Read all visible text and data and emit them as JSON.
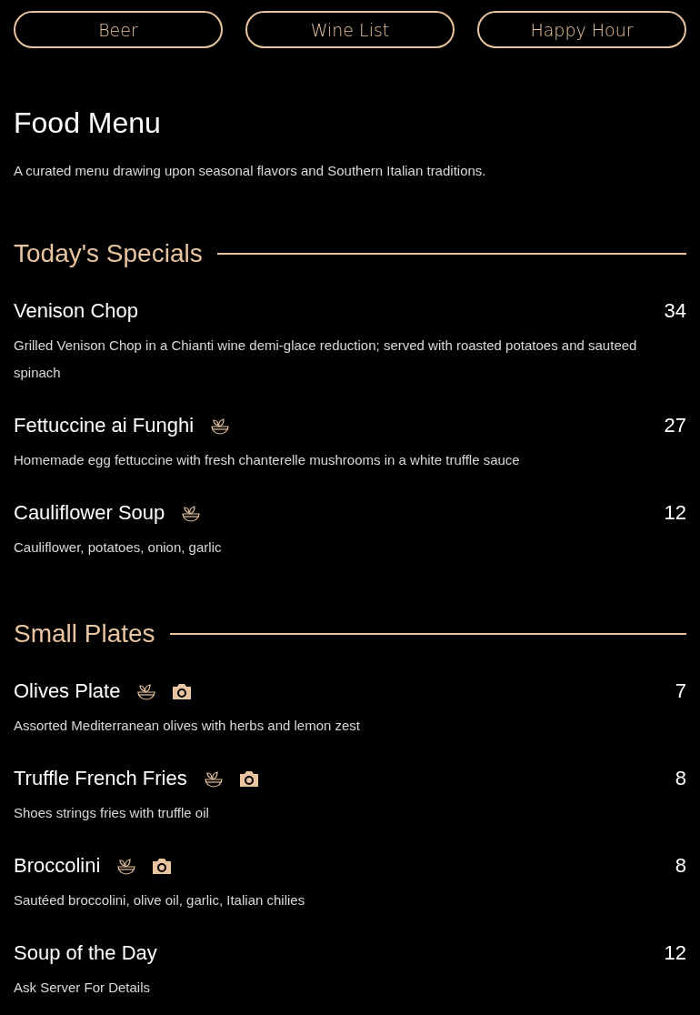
{
  "nav_buttons": [
    "Beer",
    "Wine List",
    "Happy Hour"
  ],
  "title": "Food Menu",
  "description": "A curated menu drawing upon seasonal flavors and Southern Italian traditions.",
  "sections": [
    {
      "heading": "Today's Specials",
      "items": [
        {
          "name": "Venison Chop",
          "price": "34",
          "description": "Grilled Venison Chop in a Chianti wine demi-glace reduction; served with roasted potatoes and sauteed spinach",
          "vegetarian": false,
          "photo": false
        },
        {
          "name": "Fettuccine ai Funghi",
          "price": "27",
          "description": "Homemade egg fettuccine with fresh chanterelle mushrooms in a white truffle sauce",
          "vegetarian": true,
          "photo": false
        },
        {
          "name": "Cauliflower Soup",
          "price": "12",
          "description": "Cauliflower, potatoes, onion, garlic",
          "vegetarian": true,
          "photo": false
        }
      ]
    },
    {
      "heading": "Small Plates",
      "items": [
        {
          "name": "Olives Plate",
          "price": "7",
          "description": "Assorted Mediterranean olives with herbs and lemon zest",
          "vegetarian": true,
          "photo": true
        },
        {
          "name": "Truffle French Fries",
          "price": "8",
          "description": "Shoes strings fries with truffle oil",
          "vegetarian": true,
          "photo": true
        },
        {
          "name": "Broccolini",
          "price": "8",
          "description": "Sautéed broccolini, olive oil, garlic, Italian chilies",
          "vegetarian": true,
          "photo": true
        },
        {
          "name": "Soup of the Day",
          "price": "12",
          "description": "Ask Server For Details",
          "vegetarian": false,
          "photo": false
        }
      ]
    }
  ]
}
